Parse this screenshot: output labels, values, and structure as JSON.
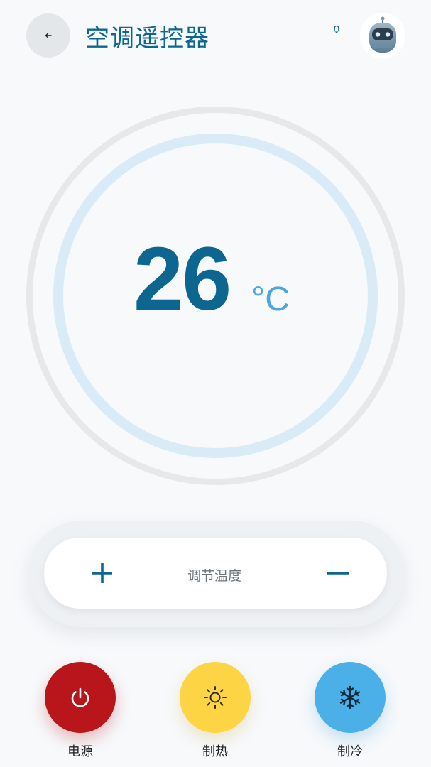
{
  "header": {
    "title": "空调遥控器",
    "back_icon": "arrow-left-icon",
    "bell_icon": "bell-icon",
    "avatar_icon": "robot-avatar"
  },
  "thermostat": {
    "temperature": "26",
    "unit": "°C"
  },
  "adjust": {
    "label": "调节温度",
    "increase_icon": "plus-icon",
    "decrease_icon": "minus-icon"
  },
  "actions": [
    {
      "label": "电源",
      "icon": "power-icon",
      "color": "#b8161a"
    },
    {
      "label": "制热",
      "icon": "sun-icon",
      "color": "#fdd444"
    },
    {
      "label": "制冷",
      "icon": "snowflake-icon",
      "color": "#4cb0e8"
    }
  ],
  "colors": {
    "primary": "#0c6690",
    "accent": "#4ba6e2",
    "background": "#f7f9fb"
  }
}
